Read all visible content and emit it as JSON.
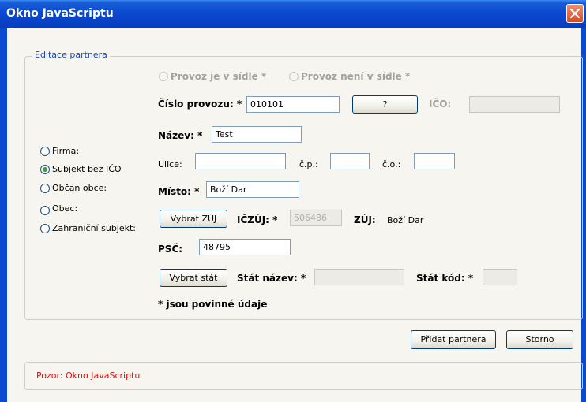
{
  "window": {
    "title": "Okno JavaScriptu"
  },
  "group": {
    "legend": "Editace partnera"
  },
  "provoz": {
    "option1": "Provoz je v sídle *",
    "option2": "Provoz není v sídle *"
  },
  "entity_types": [
    "Firma:",
    "Subjekt bez IČO",
    "Občan obce:",
    "Obec:",
    "Zahraniční subjekt:"
  ],
  "selected_entity": "Subjekt bez IČO",
  "fields": {
    "cislo_provozu_label": "Číslo provozu: *",
    "cislo_provozu_value": "010101",
    "lookup_button": "?",
    "ico_label": "IČO:",
    "ico_value": "",
    "nazev_label": "Název: *",
    "nazev_value": "Test",
    "ulice_label": "Ulice:",
    "ulice_value": "",
    "cp_label": "č.p.:",
    "cp_value": "",
    "co_label": "č.o.:",
    "co_value": "",
    "misto_label": "Místo: *",
    "misto_value": "Boží Dar",
    "vybrat_zuj_button": "Vybrat ZÚJ",
    "iczuj_label": "IČZÚJ: *",
    "iczuj_value": "506486",
    "zuj_label": "ZÚJ:",
    "zuj_value": "Boží Dar",
    "psc_label": "PSČ:",
    "psc_value": "48795",
    "vybrat_stat_button": "Vybrat stát",
    "stat_nazev_label": "Stát název: *",
    "stat_nazev_value": "",
    "stat_kod_label": "Stát kód: *",
    "stat_kod_value": "",
    "required_note": "* jsou povinné údaje"
  },
  "actions": {
    "add_partner": "Přidat partnera",
    "cancel": "Storno"
  },
  "status": {
    "message": "Pozor: Okno JavaScriptu",
    "color": "#e01010"
  },
  "colors": {
    "titlebar": "#0a49d0",
    "legend": "#1c48b4"
  }
}
